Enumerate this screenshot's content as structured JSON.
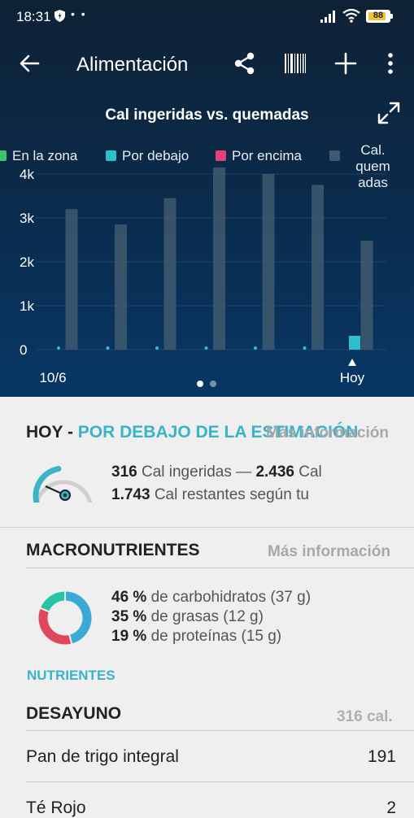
{
  "status_bar": {
    "time": "18:31",
    "dots": "• •",
    "battery": "88",
    "icons": [
      "shield-icon",
      "signal-icon",
      "wifi-icon",
      "battery-icon"
    ]
  },
  "app_bar": {
    "title": "Alimentación",
    "icons": [
      "back-arrow-icon",
      "share-icon",
      "barcode-icon",
      "plus-icon",
      "more-vert-icon"
    ]
  },
  "chart_data": {
    "type": "bar",
    "title": "Cal ingeridas vs. quemadas",
    "legend": {
      "in_zone": "En la zona",
      "below": "Por debajo",
      "above": "Por encima",
      "burned": "Cal. quemadas",
      "burned_lines": [
        "Cal. quem",
        "adas"
      ]
    },
    "categories": [
      "10/6",
      "",
      "",
      "",
      "",
      "",
      "Hoy"
    ],
    "x_labels": [
      "10/6",
      "Hoy"
    ],
    "y_ticks": [
      0,
      1000,
      2000,
      3000,
      4000
    ],
    "y_tick_labels": [
      "0",
      "1k",
      "2k",
      "3k",
      "4k"
    ],
    "ylim": [
      0,
      4000
    ],
    "series": [
      {
        "name": "Cal. quemadas",
        "color": "#3f5a70",
        "values": [
          3200,
          2850,
          3450,
          4150,
          4000,
          3750,
          2480
        ]
      },
      {
        "name": "Cal ingeridas",
        "color": "#2fbfcc",
        "values": [
          0,
          0,
          0,
          0,
          0,
          0,
          316
        ]
      }
    ],
    "legend_position": "top",
    "grid": true,
    "colors": {
      "in_zone": "#3ec46d",
      "below": "#2fbfcc",
      "above": "#e2407a",
      "burned": "#3f5a70"
    },
    "pagination": {
      "pages": 2,
      "current": 1
    }
  },
  "today": {
    "prefix": "HOY - ",
    "status": "POR DEBAJO DE LA ESTIMACIÓN",
    "more": "Más información",
    "intake": "316",
    "intake_text": " Cal ingeridas — ",
    "burned": "2.436",
    "burned_text": " Cal",
    "remaining": "1.743",
    "remaining_text": " Cal restantes según tu",
    "gauge_fraction": 0.45
  },
  "macros": {
    "heading": "MACRONUTRIENTES",
    "more": "Más información",
    "items": [
      {
        "pct": "46 %",
        "label": " de carbohidratos (37 g)",
        "value": 46,
        "color": "#3aa9d6"
      },
      {
        "pct": "35 %",
        "label": " de grasas (12 g)",
        "value": 35,
        "color": "#e0475a"
      },
      {
        "pct": "19 %",
        "label": " de proteínas (15 g)",
        "value": 19,
        "color": "#26c4a6"
      }
    ],
    "nutrients_link": "NUTRIENTES"
  },
  "meal": {
    "name": "DESAYUNO",
    "calories": "316 cal.",
    "foods": [
      {
        "name": "Pan de trigo integral",
        "cal": "191"
      },
      {
        "name": "Té Rojo",
        "cal": "2"
      }
    ]
  }
}
